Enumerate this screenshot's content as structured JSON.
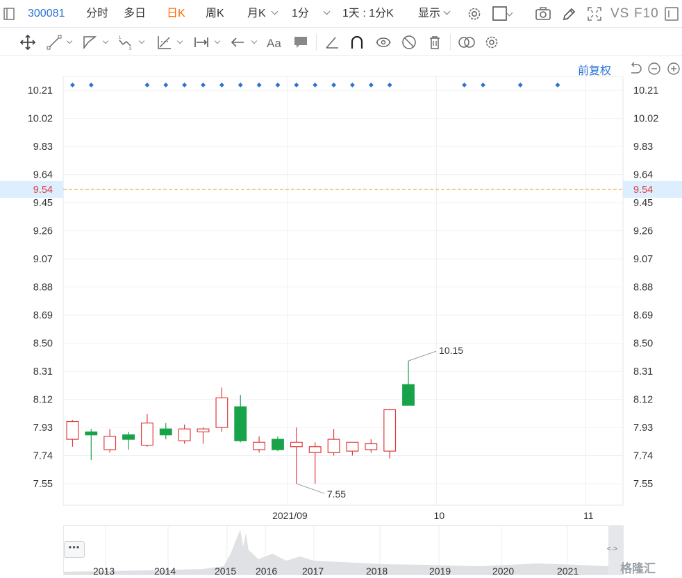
{
  "toolbar": {
    "stock_code": "300081",
    "intraday": "分时",
    "multiday": "多日",
    "daily_k": "日K",
    "weekly_k": "周K",
    "monthly_k": "月K",
    "minute": "1分",
    "period": "1天 : 1分K",
    "display": "显示",
    "compare": "VS",
    "f10": "F10"
  },
  "chart_header": {
    "adjust": "前复权"
  },
  "colors": {
    "up": "#e03a3a",
    "down": "#18a34a",
    "accent": "#2b73d6",
    "active_tab": "#ff6a00",
    "current_price_line": "#f0a030",
    "current_price_text": "#e03a3a"
  },
  "icons": {
    "chart_toggle": "square-outline-icon",
    "settings": "gear-icon",
    "screenshot": "camera-icon",
    "draw": "pencil-icon",
    "fullscreen": "fullscreen-icon",
    "window": "window-icon",
    "undo": "undo-icon",
    "zoom_out": "zoom-out-icon",
    "zoom_in": "zoom-in-icon"
  },
  "chart_data": {
    "type": "candlestick",
    "y_ticks": [
      "10.21",
      "10.02",
      "9.83",
      "9.64",
      "9.45",
      "9.26",
      "9.07",
      "8.88",
      "8.69",
      "8.50",
      "8.31",
      "8.12",
      "7.93",
      "7.74",
      "7.55"
    ],
    "ylim": [
      7.4,
      10.3
    ],
    "current_price": "9.54",
    "max_label": "10.15",
    "min_label": "7.55",
    "x_ticks": [
      {
        "label": "2021/09",
        "index": 11.5
      },
      {
        "label": "10",
        "index": 19.5
      },
      {
        "label": "11",
        "index": 27.5
      }
    ],
    "event_marker_indices": [
      0,
      1,
      4,
      5,
      6,
      7,
      8,
      9,
      10,
      11,
      12,
      13,
      14,
      15,
      16,
      17,
      21,
      22,
      24,
      26
    ],
    "candles": [
      {
        "o": 7.85,
        "h": 7.98,
        "l": 7.8,
        "c": 7.97
      },
      {
        "o": 7.9,
        "h": 7.92,
        "l": 7.71,
        "c": 7.88
      },
      {
        "o": 7.78,
        "h": 7.92,
        "l": 7.76,
        "c": 7.87
      },
      {
        "o": 7.88,
        "h": 7.9,
        "l": 7.78,
        "c": 7.85
      },
      {
        "o": 7.81,
        "h": 8.02,
        "l": 7.8,
        "c": 7.96
      },
      {
        "o": 7.92,
        "h": 7.96,
        "l": 7.85,
        "c": 7.88
      },
      {
        "o": 7.84,
        "h": 7.95,
        "l": 7.82,
        "c": 7.92
      },
      {
        "o": 7.9,
        "h": 7.93,
        "l": 7.82,
        "c": 7.92
      },
      {
        "o": 7.93,
        "h": 8.2,
        "l": 7.9,
        "c": 8.13
      },
      {
        "o": 8.07,
        "h": 8.15,
        "l": 7.83,
        "c": 7.84
      },
      {
        "o": 7.78,
        "h": 7.87,
        "l": 7.76,
        "c": 7.83
      },
      {
        "o": 7.85,
        "h": 7.87,
        "l": 7.77,
        "c": 7.78
      },
      {
        "o": 7.8,
        "h": 7.93,
        "l": 7.55,
        "c": 7.83
      },
      {
        "o": 7.76,
        "h": 7.83,
        "l": 7.55,
        "c": 7.8
      },
      {
        "o": 7.76,
        "h": 7.92,
        "l": 7.74,
        "c": 7.85
      },
      {
        "o": 7.77,
        "h": 7.83,
        "l": 7.74,
        "c": 7.83
      },
      {
        "o": 7.78,
        "h": 7.85,
        "l": 7.76,
        "c": 7.82
      },
      {
        "o": 7.77,
        "h": 8.05,
        "l": 7.72,
        "c": 8.05
      },
      {
        "o": 8.22,
        "h": 8.38,
        "l": 8.08,
        "c": 8.08
      }
    ]
  }
}
